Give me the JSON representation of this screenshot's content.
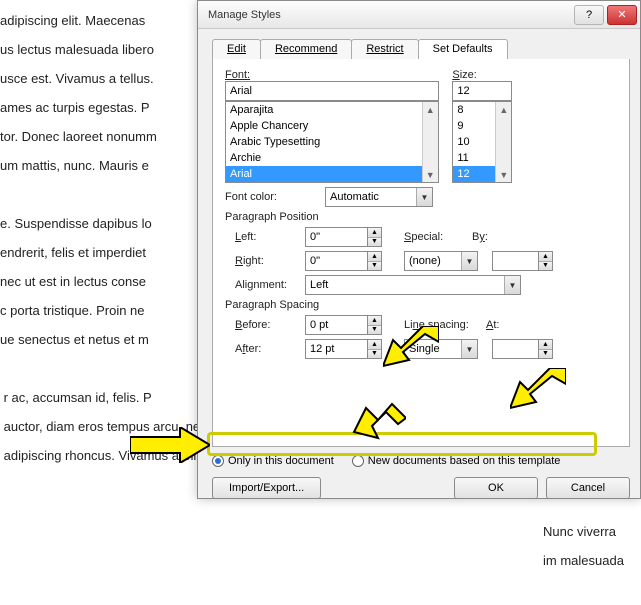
{
  "bg_lines": "adipiscing elit. Maecenas\nus lectus malesuada libero\nusce est. Vivamus a tellus.\names ac turpis egestas. P\ntor. Donec laoreet nonumm\num mattis, nunc. Mauris e\n\ne. Suspendisse dapibus lo\nendrerit, felis et imperdiet\nnec ut est in lectus conse\nc porta tristique. Proin ne\nue senectus et netus et m\n\n r ac, accumsan id, felis. P\n auctor, diam eros tempus arcu, nec vulputate augue\n adipiscing rhoncus. Vivamus a mi. Morbi neque. Aliquam",
  "bg_right": "Nunc viverra im\nmalesuada",
  "dialog": {
    "title": "Manage Styles",
    "tabs": [
      "Edit",
      "Recommend",
      "Restrict",
      "Set Defaults"
    ],
    "active_tab": 3,
    "font_label": "Font:",
    "font_value": "Arial",
    "font_items": [
      "Aparajita",
      "Apple Chancery",
      "Arabic Typesetting",
      "Archie",
      "Arial"
    ],
    "size_label": "Size:",
    "size_value": "12",
    "size_items": [
      "8",
      "9",
      "10",
      "11",
      "12"
    ],
    "fontcolor_label": "Font color:",
    "fontcolor_value": "Automatic",
    "section_pos": "Paragraph Position",
    "left_label": "Left:",
    "left_value": "0\"",
    "right_label": "Right:",
    "right_value": "0\"",
    "special_label": "Special:",
    "special_value": "(none)",
    "by_label": "By:",
    "by_value": "",
    "alignment_label": "Alignment:",
    "alignment_value": "Left",
    "section_space": "Paragraph Spacing",
    "before_label": "Before:",
    "before_value": "0 pt",
    "after_label": "After:",
    "after_value": "12 pt",
    "linespacing_label": "Line spacing:",
    "linespacing_value": "Single",
    "at_label": "At:",
    "at_value": "",
    "radio1": "Only in this document",
    "radio2": "New documents based on this template",
    "import_btn": "Import/Export...",
    "ok_btn": "OK",
    "cancel_btn": "Cancel"
  },
  "help_glyph": "?",
  "close_glyph": "✕"
}
